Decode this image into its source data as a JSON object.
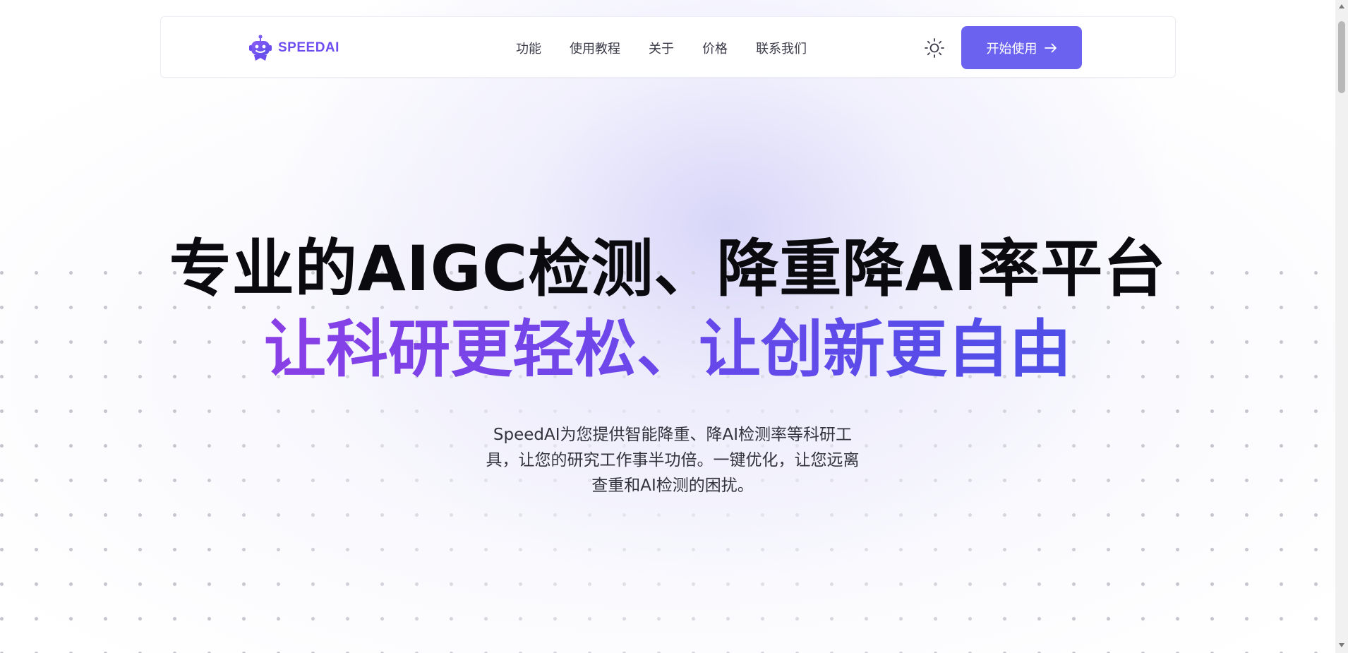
{
  "brand": {
    "name": "SPEEDAI",
    "color": "#6d4df0"
  },
  "nav": {
    "links": [
      {
        "label": "功能"
      },
      {
        "label": "使用教程"
      },
      {
        "label": "关于"
      },
      {
        "label": "价格"
      },
      {
        "label": "联系我们"
      }
    ],
    "theme_toggle_icon": "sun-icon",
    "cta_label": "开始使用",
    "cta_icon": "arrow-right-icon",
    "cta_color": "#6b63f0"
  },
  "hero": {
    "title_line1": "专业的AIGC检测、降重降AI率平台",
    "title_line2": "让科研更轻松、让创新更自由",
    "subtitle": "SpeedAI为您提供智能降重、降AI检测率等科研工具，让您的研究工作事半功倍。一键优化，让您远离查重和AI检测的困扰。"
  }
}
